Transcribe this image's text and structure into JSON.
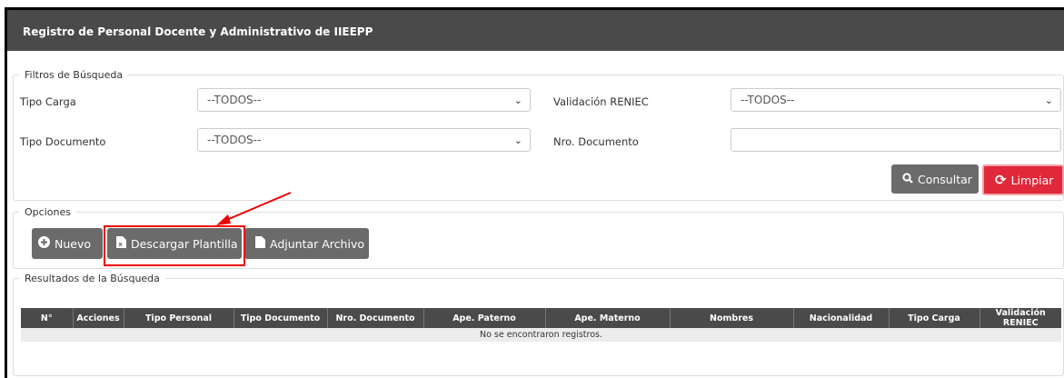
{
  "header": {
    "title": "Registro de Personal Docente y Administrativo de IIEEPP"
  },
  "filters": {
    "legend": "Filtros de Búsqueda",
    "tipo_carga": {
      "label": "Tipo Carga",
      "value": "--TODOS--"
    },
    "validacion_reniec": {
      "label": "Validación RENIEC",
      "value": "--TODOS--"
    },
    "tipo_documento": {
      "label": "Tipo Documento",
      "value": "--TODOS--"
    },
    "nro_documento": {
      "label": "Nro. Documento",
      "value": ""
    },
    "consultar_label": "Consultar",
    "limpiar_label": "Limpiar"
  },
  "options": {
    "legend": "Opciones",
    "nuevo_label": "Nuevo",
    "descargar_label": "Descargar Plantilla",
    "adjuntar_label": "Adjuntar Archivo"
  },
  "results": {
    "legend": "Resultados de la Búsqueda",
    "columns": [
      "N°",
      "Acciones",
      "Tipo Personal",
      "Tipo Documento",
      "Nro. Documento",
      "Ape. Paterno",
      "Ape. Materno",
      "Nombres",
      "Nacionalidad",
      "Tipo Carga",
      "Validación RENIEC"
    ],
    "empty_message": "No se encontraron registros."
  },
  "colors": {
    "header_bg": "#4a4a4a",
    "danger": "#e0283a",
    "button_dark": "#6b6b6b",
    "annotation": "#ee0000"
  }
}
